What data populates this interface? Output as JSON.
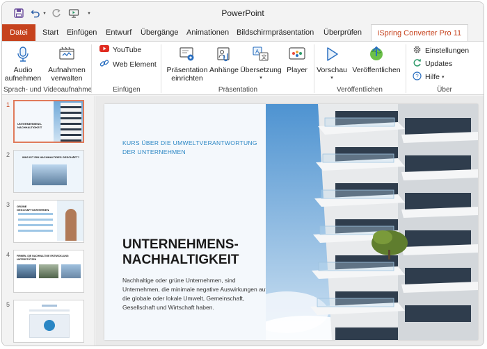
{
  "app": {
    "title": "PowerPoint"
  },
  "quick_access": {
    "icons": [
      "save-icon",
      "undo-icon",
      "redo-icon",
      "slideshow-from-start-icon",
      "customize-quick-access-icon"
    ]
  },
  "tabs": [
    "Datei",
    "Start",
    "Einfügen",
    "Entwurf",
    "Übergänge",
    "Animationen",
    "Bildschirmpräsentation",
    "Überprüfen",
    "iSpring Converter Pro 11"
  ],
  "active_tab": "iSpring Converter Pro 11",
  "ribbon": {
    "groups": {
      "recording": {
        "label": "Sprach- und Videoaufnahme",
        "audio": {
          "line1": "Audio",
          "line2": "aufnehmen",
          "icon": "microphone-icon"
        },
        "manage": {
          "line1": "Aufnahmen",
          "line2": "verwalten",
          "icon": "manage-recordings-icon"
        }
      },
      "insert": {
        "label": "Einfügen",
        "youtube": {
          "label": "YouTube",
          "icon": "youtube-icon"
        },
        "web": {
          "label": "Web Element",
          "icon": "link-icon"
        }
      },
      "presentation": {
        "label": "Präsentation",
        "setup": {
          "line1": "Präsentation",
          "line2": "einrichten",
          "icon": "presentation-setup-icon"
        },
        "attachments": {
          "label": "Anhänge",
          "icon": "attachments-icon"
        },
        "translation": {
          "label": "Übersetzung",
          "icon": "translation-icon"
        },
        "player": {
          "label": "Player",
          "icon": "player-icon"
        }
      },
      "publish": {
        "label": "Veröffentlichen",
        "preview": {
          "label": "Vorschau",
          "icon": "preview-play-icon"
        },
        "publish": {
          "label": "Veröffentlichen",
          "icon": "publish-icon"
        }
      },
      "about": {
        "label": "Über",
        "settings": {
          "label": "Einstellungen",
          "icon": "gear-icon"
        },
        "updates": {
          "label": "Updates",
          "icon": "refresh-icon"
        },
        "help": {
          "label": "Hilfe",
          "icon": "help-icon"
        }
      }
    }
  },
  "thumbnails": [
    {
      "number": "1",
      "title": "UNTERNEHMENS-NACHHALTIGKEIT",
      "selected": true
    },
    {
      "number": "2",
      "title": "WAS IST EIN NACHHALTIGES GESCHÄFT?"
    },
    {
      "number": "3",
      "title": "GRÜNE GESCHÄFTSKRITERIEN"
    },
    {
      "number": "4",
      "title": "FIRMEN, DIE NACHHALTIGE ENTWICKLUNG UNTERSTÜTZEN"
    },
    {
      "number": "5",
      "title": ""
    }
  ],
  "slide": {
    "eyebrow": "KURS ÜBER DIE UMWELTVERANTWORTUNG DER UNTERNEHMEN",
    "title": "UNTERNEHMENS-NACHHALTIGKEIT",
    "body": "Nachhaltige oder grüne Unternehmen, sind Unternehmen, die minimale negative Auswirkungen auf die globale oder lokale Umwelt, Gemeinschaft, Gesellschaft und Wirtschaft haben."
  },
  "colors": {
    "accent": "#c6421d",
    "eyebrow": "#2a86c4",
    "selection": "#e07a5a"
  }
}
